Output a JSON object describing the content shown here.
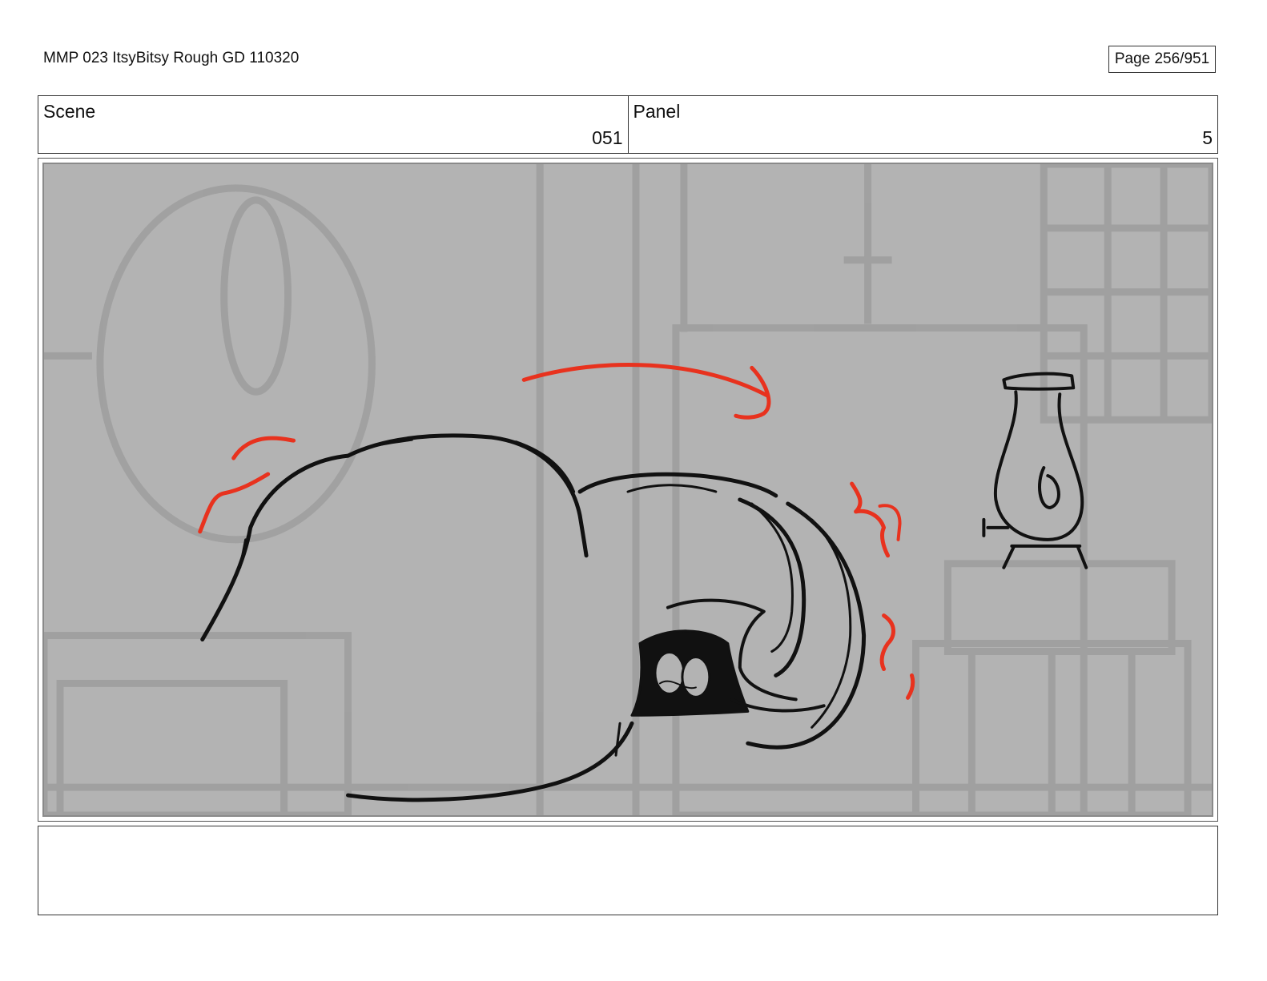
{
  "header": {
    "title": "MMP 023 ItsyBitsy Rough GD 110320",
    "page": "Page 256/951"
  },
  "scene": {
    "label": "Scene",
    "value": "051"
  },
  "panel": {
    "label": "Panel",
    "value": "5"
  },
  "drawing": {
    "background_color": "#b3b3b3",
    "line_color": "#111111",
    "effect_color": "#e8321e"
  },
  "notes": {
    "text": ""
  }
}
